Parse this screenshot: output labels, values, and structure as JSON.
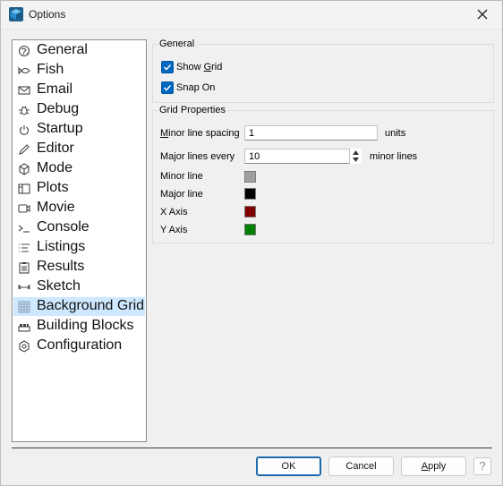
{
  "window": {
    "title": "Options",
    "icon": "cube-app-icon"
  },
  "sidebar": {
    "items": [
      {
        "label": "General",
        "icon": "globe-icon"
      },
      {
        "label": "Fish",
        "icon": "fish-icon"
      },
      {
        "label": "Email",
        "icon": "envelope-icon"
      },
      {
        "label": "Debug",
        "icon": "bug-icon"
      },
      {
        "label": "Startup",
        "icon": "power-icon"
      },
      {
        "label": "Editor",
        "icon": "pencil-icon"
      },
      {
        "label": "Mode",
        "icon": "cube-icon"
      },
      {
        "label": "Plots",
        "icon": "plots-panel-icon"
      },
      {
        "label": "Movie",
        "icon": "video-camera-icon"
      },
      {
        "label": "Console",
        "icon": "terminal-prompt-icon"
      },
      {
        "label": "Listings",
        "icon": "list-icon"
      },
      {
        "label": "Results",
        "icon": "clipboard-icon"
      },
      {
        "label": "Sketch",
        "icon": "dimension-sketch-icon"
      },
      {
        "label": "Background Grid",
        "icon": "grid-icon"
      },
      {
        "label": "Building Blocks",
        "icon": "blocks-icon"
      },
      {
        "label": "Configuration",
        "icon": "gear-icon"
      }
    ],
    "selected": "Background Grid"
  },
  "general_group": {
    "title": "General",
    "show_grid": {
      "label_pre": "Show ",
      "label_ul": "G",
      "label_post": "rid",
      "checked": true
    },
    "snap_on": {
      "label": "Snap On",
      "checked": true
    }
  },
  "grid_props": {
    "title": "Grid Properties",
    "minor_spacing": {
      "label_ul": "M",
      "label_post": "inor line spacing",
      "value": "1",
      "unit": "units"
    },
    "major_every": {
      "label": "Major lines every",
      "value": "10",
      "unit": "minor lines"
    },
    "colors": [
      {
        "label": "Minor line",
        "color": "#a0a0a0"
      },
      {
        "label": "Major line",
        "color": "#000000"
      },
      {
        "label": "X Axis",
        "color": "#800000"
      },
      {
        "label": "Y Axis",
        "color": "#008000"
      }
    ]
  },
  "buttons": {
    "ok": "OK",
    "cancel": "Cancel",
    "apply_ul": "A",
    "apply_post": "pply",
    "help": "?"
  }
}
